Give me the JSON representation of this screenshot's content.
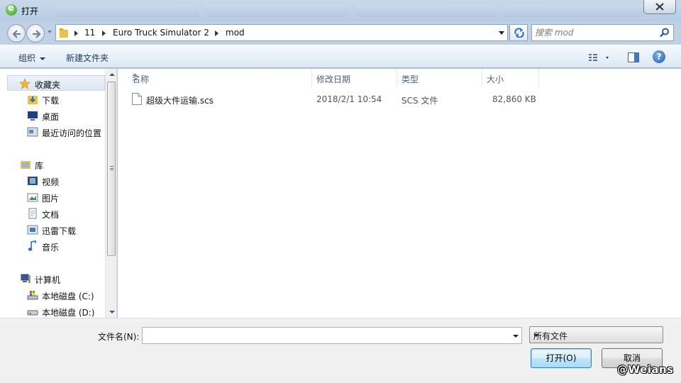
{
  "window": {
    "title": "打开",
    "icon": "ie-icon"
  },
  "address": {
    "crumbs": [
      "11",
      "Euro Truck Simulator 2",
      "mod"
    ],
    "search_placeholder": "搜索 mod"
  },
  "toolbar": {
    "organize": "组织",
    "new_folder": "新建文件夹"
  },
  "nav": {
    "items": [
      {
        "label": "收藏夹",
        "icon": "star-icon",
        "level": 0
      },
      {
        "label": "下载",
        "icon": "download-folder-icon",
        "level": 1
      },
      {
        "label": "桌面",
        "icon": "desktop-icon",
        "level": 1
      },
      {
        "label": "最近访问的位置",
        "icon": "recent-places-icon",
        "level": 1
      },
      {
        "label": "库",
        "icon": "library-icon",
        "level": 0
      },
      {
        "label": "视频",
        "icon": "video-library-icon",
        "level": 1
      },
      {
        "label": "图片",
        "icon": "pictures-library-icon",
        "level": 1
      },
      {
        "label": "文档",
        "icon": "documents-library-icon",
        "level": 1
      },
      {
        "label": "迅雷下载",
        "icon": "thunder-download-icon",
        "level": 1
      },
      {
        "label": "音乐",
        "icon": "music-library-icon",
        "level": 1
      },
      {
        "label": "计算机",
        "icon": "computer-icon",
        "level": 0
      },
      {
        "label": "本地磁盘 (C:)",
        "icon": "windows-drive-icon",
        "level": 1
      },
      {
        "label": "本地磁盘 (D:)",
        "icon": "drive-icon",
        "level": 1
      }
    ]
  },
  "columns": {
    "name": "名称",
    "modified": "修改日期",
    "type": "类型",
    "size": "大小"
  },
  "files": [
    {
      "name": "超级大件运输.scs",
      "modified": "2018/2/1 10:54",
      "type": "SCS 文件",
      "size": "82,860 KB"
    }
  ],
  "footer": {
    "filename_label": "文件名(N):",
    "filename_value": "",
    "filetype_value": "所有文件",
    "open_label": "打开(O)",
    "cancel_label": "取消"
  },
  "watermark": "@Weians",
  "colors": {
    "accent": "#3c7fb1",
    "title_bar": "#c0d1e6",
    "toolbar_text": "#1e395b"
  }
}
